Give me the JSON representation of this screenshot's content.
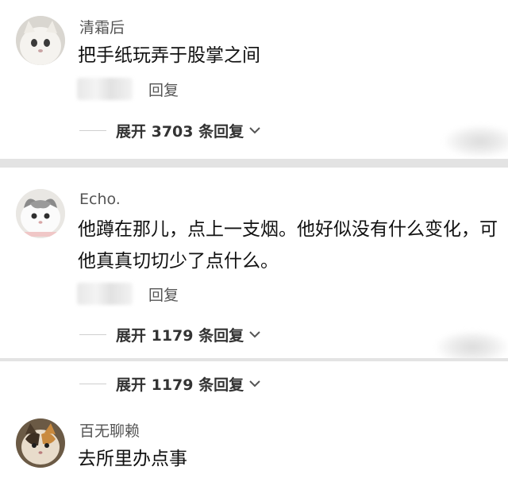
{
  "comments": [
    {
      "username": "清霜后",
      "content": "把手纸玩弄于股掌之间",
      "reply_label": "回复",
      "expand_label": "展开 3703 条回复"
    },
    {
      "username": "Echo.",
      "content": "他蹲在那儿，点上一支烟。他好似没有什么变化，可他真真切切少了点什么。",
      "reply_label": "回复",
      "expand_label": "展开 1179 条回复"
    },
    {
      "expand_label": "展开 1179 条回复"
    },
    {
      "username": "百无聊赖",
      "content": "去所里办点事"
    }
  ],
  "colors": {
    "separator": "#e3e3e3",
    "text_primary": "#111111",
    "text_secondary": "#555555"
  },
  "icons": {
    "avatar_1": "white-cat-avatar",
    "avatar_2": "grey-white-cat-avatar",
    "avatar_3": "calico-cat-avatar",
    "chevron": "chevron-down-icon"
  }
}
